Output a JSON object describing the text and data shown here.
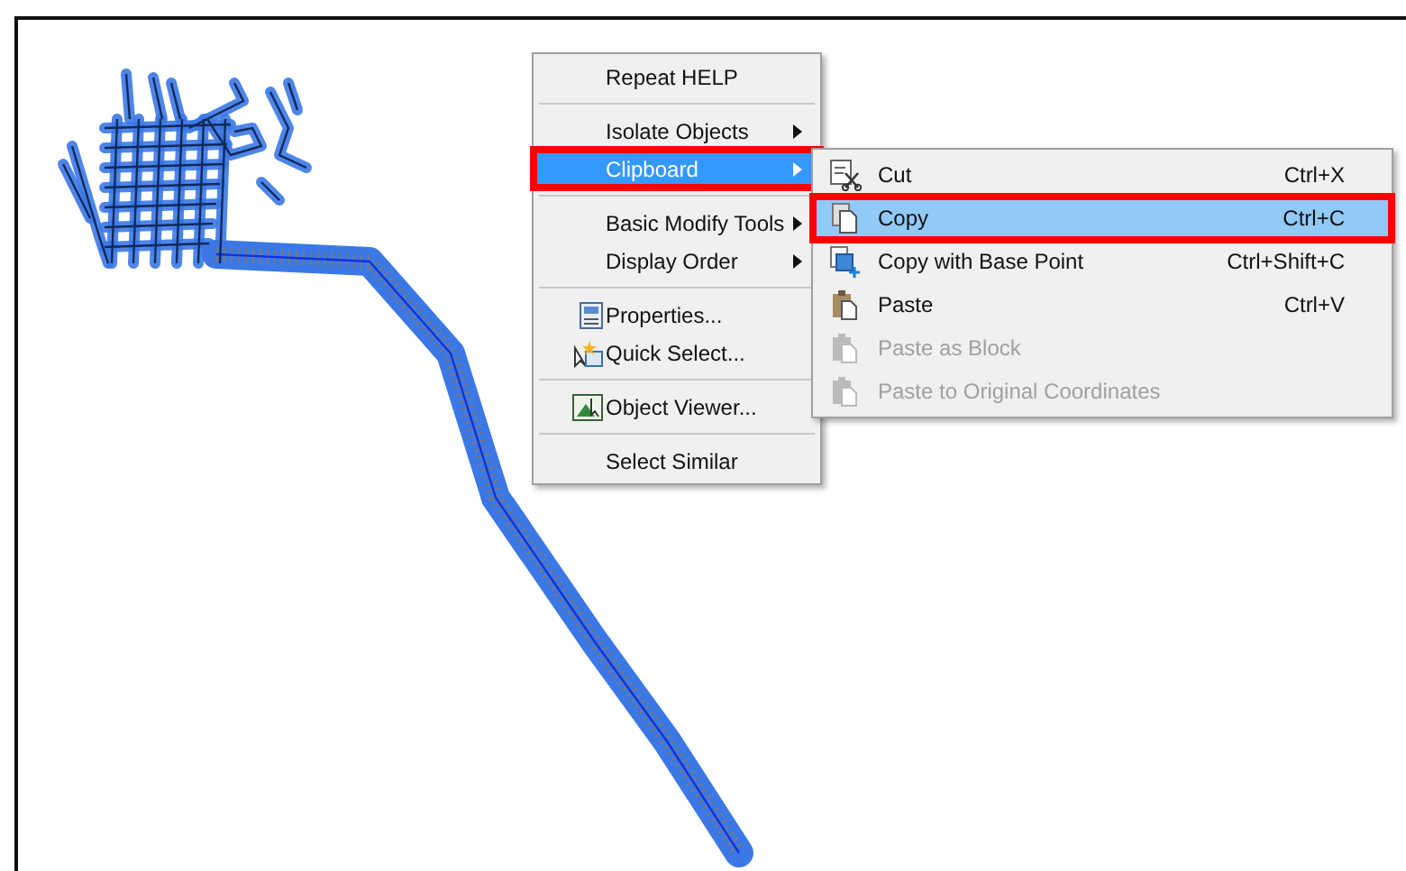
{
  "context_menu": {
    "items": [
      {
        "kind": "item",
        "label": "Repeat HELP",
        "submenu": false,
        "selected": false,
        "annotated": false
      },
      {
        "kind": "separator"
      },
      {
        "kind": "item",
        "label": "Isolate Objects",
        "submenu": true,
        "selected": false,
        "annotated": false
      },
      {
        "kind": "item",
        "label": "Clipboard",
        "submenu": true,
        "selected": true,
        "annotated": true
      },
      {
        "kind": "separator"
      },
      {
        "kind": "item",
        "label": "Basic Modify Tools",
        "submenu": true,
        "selected": false,
        "annotated": false
      },
      {
        "kind": "item",
        "label": "Display Order",
        "submenu": true,
        "selected": false,
        "annotated": false
      },
      {
        "kind": "separator"
      },
      {
        "kind": "item",
        "label": "Properties...",
        "submenu": false,
        "selected": false,
        "annotated": false
      },
      {
        "kind": "item",
        "label": "Quick Select...",
        "submenu": false,
        "selected": false,
        "annotated": false
      },
      {
        "kind": "separator"
      },
      {
        "kind": "item",
        "label": "Object Viewer...",
        "submenu": false,
        "selected": false,
        "annotated": false
      },
      {
        "kind": "separator"
      },
      {
        "kind": "item",
        "label": "Select Similar",
        "submenu": false,
        "selected": false,
        "annotated": false
      }
    ]
  },
  "clipboard_submenu": {
    "items": [
      {
        "label": "Cut",
        "shortcut": "Ctrl+X",
        "disabled": false,
        "selected": false,
        "annotated": false
      },
      {
        "label": "Copy",
        "shortcut": "Ctrl+C",
        "disabled": false,
        "selected": true,
        "annotated": true
      },
      {
        "label": "Copy with Base Point",
        "shortcut": "Ctrl+Shift+C",
        "disabled": false,
        "selected": false,
        "annotated": false
      },
      {
        "label": "Paste",
        "shortcut": "Ctrl+V",
        "disabled": false,
        "selected": false,
        "annotated": false
      },
      {
        "label": "Paste as Block",
        "disabled": true,
        "selected": false,
        "annotated": false
      },
      {
        "label": "Paste to Original Coordinates",
        "disabled": true,
        "selected": false,
        "annotated": false
      }
    ]
  }
}
